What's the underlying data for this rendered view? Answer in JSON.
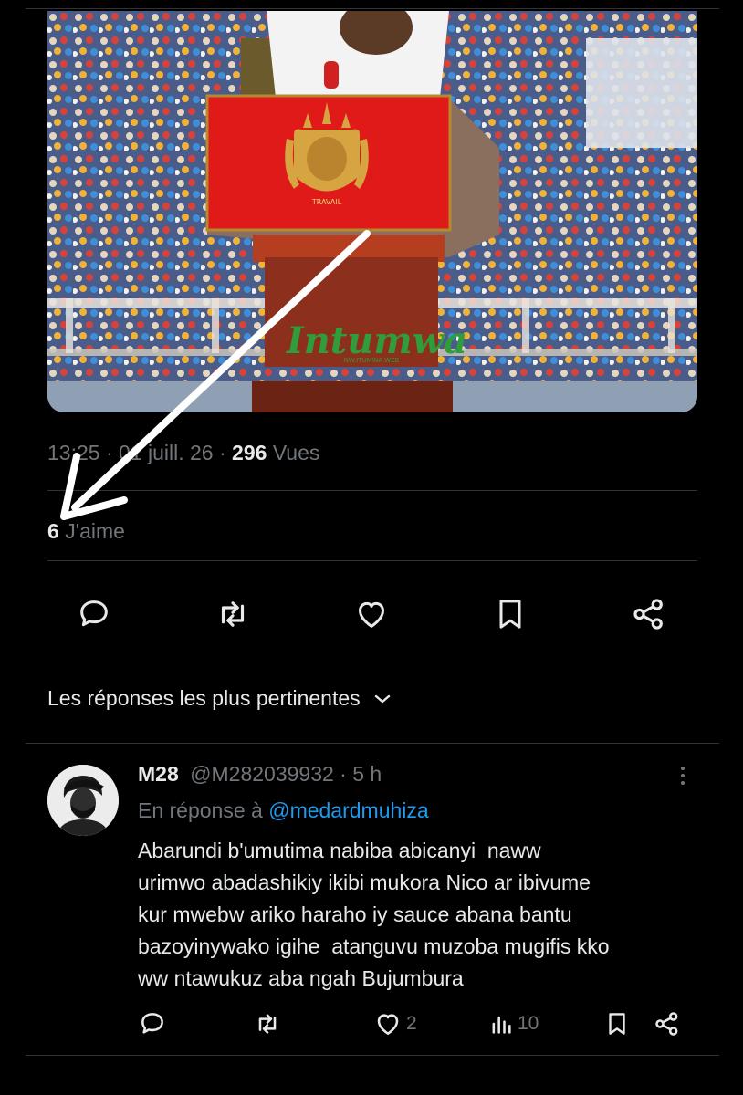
{
  "tweet": {
    "time": "13:25",
    "date": "01 juill. 26",
    "views_count": "296",
    "views_label": "Vues",
    "likes_count": "6",
    "likes_label": "J'aime",
    "media": {
      "watermark": "Intumwa",
      "watermark_sub": "NW.ITUMWA.WEB",
      "lectern_motto": "TRAVAIL",
      "colors": {
        "lectern_red": "#e01919",
        "crest_gold": "#d6a441",
        "watermark_green": "#2e9d3a"
      }
    }
  },
  "actions": {
    "reply_icon": "speech-bubble-icon",
    "retweet_icon": "retweet-icon",
    "like_icon": "heart-icon",
    "bookmark_icon": "bookmark-icon",
    "share_icon": "share-icon"
  },
  "replies_sort": {
    "label": "Les réponses les plus pertinentes",
    "icon": "chevron-down-icon"
  },
  "reply": {
    "display_name": "M28",
    "handle": "@M282039932",
    "separator": "·",
    "time": "5 h",
    "in_reply_prefix": "En réponse à",
    "in_reply_handle": "@medardmuhiza",
    "text": "Abarundi b'umutima nabiba abicanyi  naww\nurimwo abadashikiy ikibi mukora Nico ar ibivume\nkur mwebw ariko haraho iy sauce abana bantu\nbazoyinywako igihe  atanguvu muzoba mugifis kko\nww ntawukuz aba ngah Bujumbura",
    "likes": "2",
    "views": "10"
  },
  "annotation": {
    "arrow_color": "#ffffff"
  }
}
